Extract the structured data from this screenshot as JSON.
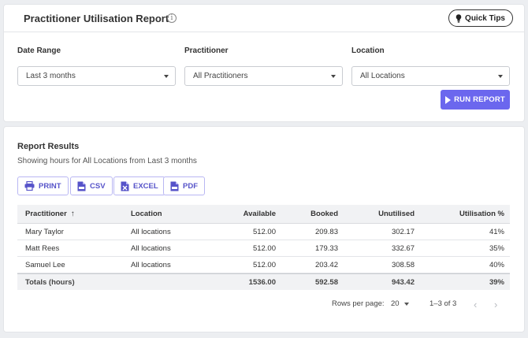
{
  "header": {
    "title": "Practitioner Utilisation Report",
    "info_icon": "info-icon",
    "quick_tips_label": "Quick Tips"
  },
  "filters": {
    "date_range": {
      "label": "Date Range",
      "value": "Last 3 months"
    },
    "practitioner": {
      "label": "Practitioner",
      "value": "All Practitioners"
    },
    "location": {
      "label": "Location",
      "value": "All Locations"
    }
  },
  "run_button_label": "RUN REPORT",
  "accent_color": "#6b67ee",
  "results": {
    "title": "Report Results",
    "subtitle": "Showing hours for All Locations from Last 3 months",
    "exports": [
      {
        "label": "PRINT",
        "icon": "printer-icon"
      },
      {
        "label": "CSV",
        "icon": "csv-file-icon"
      },
      {
        "label": "EXCEL",
        "icon": "excel-file-icon"
      },
      {
        "label": "PDF",
        "icon": "pdf-file-icon"
      }
    ]
  },
  "table": {
    "columns": [
      "Practitioner",
      "Location",
      "Available",
      "Booked",
      "Unutilised",
      "Utilisation %"
    ],
    "sort_indicator": "↑",
    "rows": [
      [
        "Mary Taylor",
        "All locations",
        "512.00",
        "209.83",
        "302.17",
        "41%"
      ],
      [
        "Matt Rees",
        "All locations",
        "512.00",
        "179.33",
        "332.67",
        "35%"
      ],
      [
        "Samuel Lee",
        "All locations",
        "512.00",
        "203.42",
        "308.58",
        "40%"
      ]
    ],
    "totals": [
      "Totals (hours)",
      "",
      "1536.00",
      "592.58",
      "943.42",
      "39%"
    ]
  },
  "pagination": {
    "rows_per_page_label": "Rows per page:",
    "rows_per_page_value": "20",
    "range": "1–3 of 3",
    "prev_icon": "chevron-left-icon",
    "next_icon": "chevron-right-icon"
  }
}
